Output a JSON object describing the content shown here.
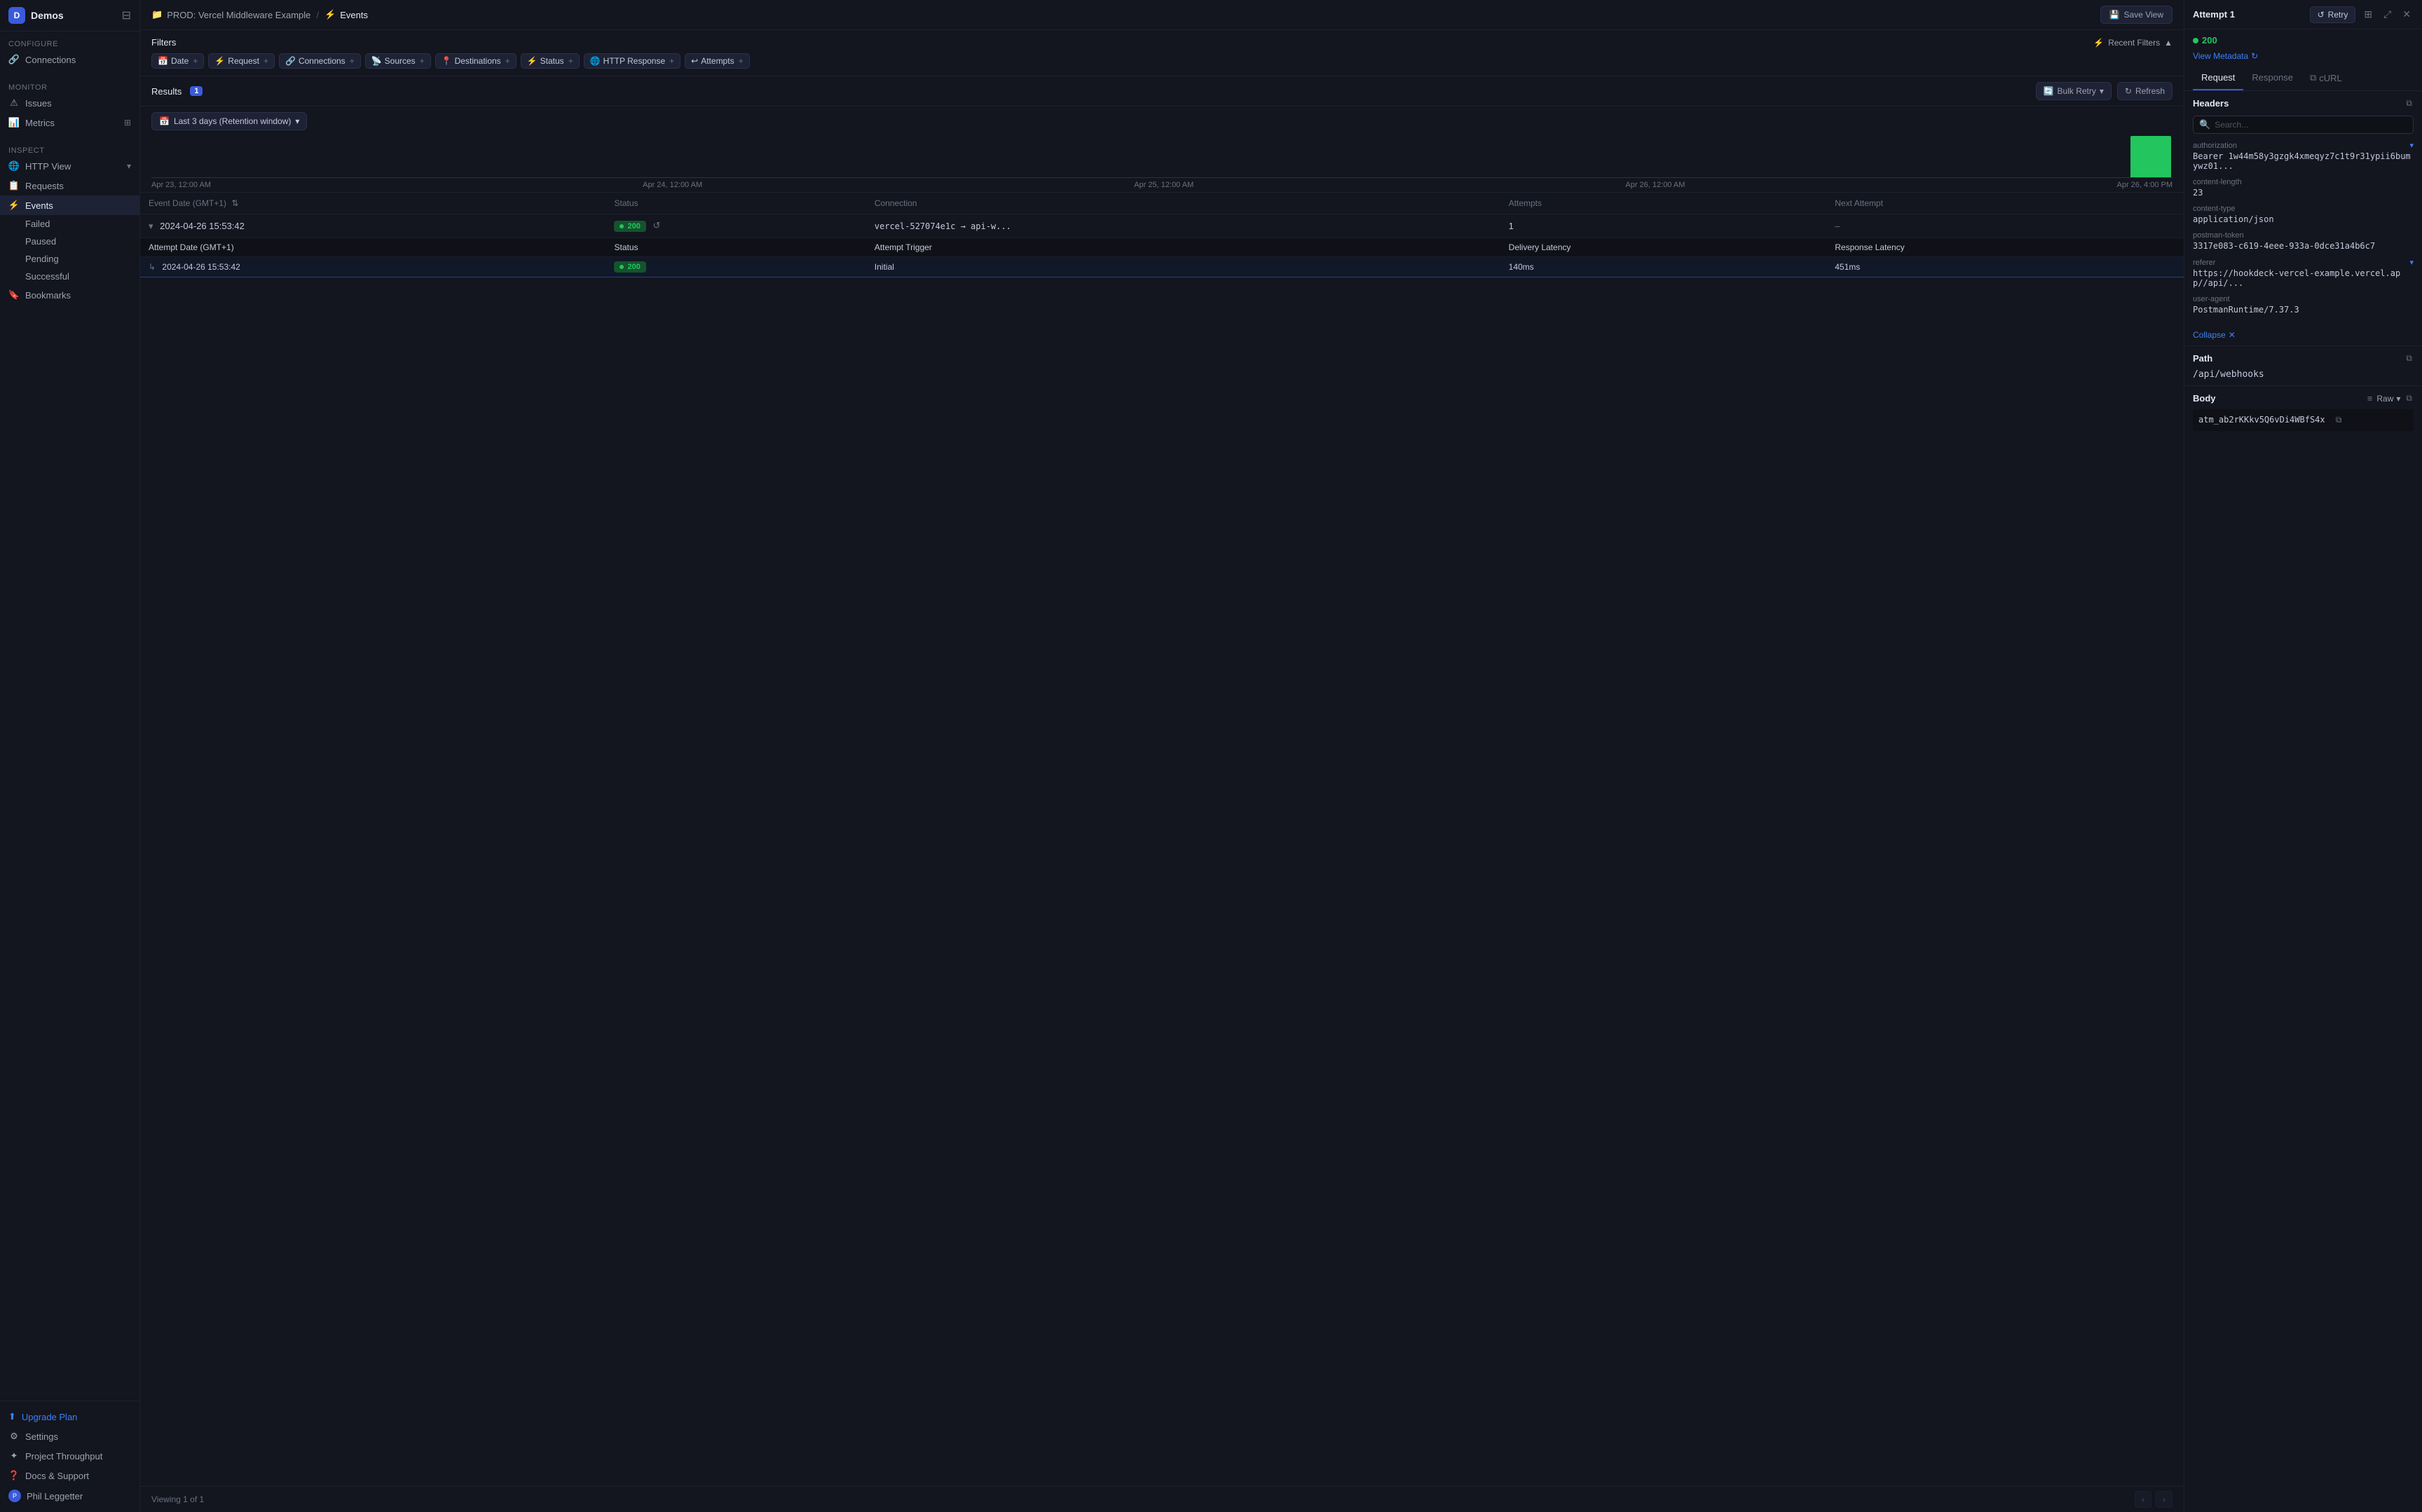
{
  "app": {
    "workspace": "Demos",
    "logo_letter": "D"
  },
  "sidebar": {
    "configure_label": "Configure",
    "connections_label": "Connections",
    "monitor_label": "Monitor",
    "issues_label": "Issues",
    "metrics_label": "Metrics",
    "inspect_label": "Inspect",
    "http_view_label": "HTTP View",
    "requests_label": "Requests",
    "events_label": "Events",
    "events_sub": [
      {
        "label": "Failed"
      },
      {
        "label": "Paused"
      },
      {
        "label": "Pending"
      },
      {
        "label": "Successful"
      }
    ],
    "bookmarks_label": "Bookmarks",
    "upgrade_label": "Upgrade Plan",
    "settings_label": "Settings",
    "project_throughput_label": "Project Throughput",
    "docs_support_label": "Docs & Support",
    "user_label": "Phil Leggetter"
  },
  "topbar": {
    "breadcrumb_icon": "📁",
    "breadcrumb_project": "PROD: Vercel Middleware Example",
    "breadcrumb_separator": "/",
    "breadcrumb_events": "Events",
    "save_view_label": "Save View"
  },
  "filters": {
    "title": "Filters",
    "recent_filters_label": "Recent Filters",
    "chips": [
      {
        "label": "Date",
        "icon": "📅"
      },
      {
        "label": "Request",
        "icon": "⚡"
      },
      {
        "label": "Connections",
        "icon": "🔗"
      },
      {
        "label": "Sources",
        "icon": "📡"
      },
      {
        "label": "Destinations",
        "icon": "📍"
      },
      {
        "label": "Status",
        "icon": "⚡"
      },
      {
        "label": "HTTP Response",
        "icon": "🌐"
      },
      {
        "label": "Attempts",
        "icon": "↩"
      }
    ]
  },
  "results": {
    "label": "Results",
    "count": "1",
    "bulk_retry_label": "Bulk Retry",
    "refresh_label": "Refresh",
    "date_range_label": "Last 3 days (Retention window)"
  },
  "chart": {
    "dates": [
      "Apr 23, 12:00 AM",
      "Apr 24, 12:00 AM",
      "Apr 25, 12:00 AM",
      "Apr 26, 12:00 AM",
      "Apr 26, 4:00 PM"
    ],
    "bars": [
      0,
      0,
      0,
      0,
      0,
      0,
      0,
      0,
      0,
      0,
      0,
      0,
      0,
      0,
      0,
      0,
      0,
      0,
      0,
      0,
      0,
      0,
      0,
      0,
      0,
      0,
      0,
      0,
      0,
      0,
      0,
      0,
      0,
      0,
      0,
      0,
      0,
      0,
      0,
      0,
      0,
      0,
      0,
      0,
      0,
      0,
      0,
      1
    ]
  },
  "table": {
    "columns": [
      "Event Date (GMT+1)",
      "Status",
      "Connection",
      "Attempts",
      "Next Attempt"
    ],
    "sub_columns": [
      "Attempt Date (GMT+1)",
      "Status",
      "Attempt Trigger",
      "Delivery Latency",
      "Response Latency"
    ],
    "rows": [
      {
        "date": "2024-04-26 15:53:42",
        "status": "200",
        "connection": "vercel-527074e1c → api-w...",
        "attempts": "1",
        "next_attempt": "–",
        "expanded": true,
        "sub_rows": [
          {
            "date": "2024-04-26 15:53:42",
            "status": "200",
            "trigger": "Initial",
            "delivery_latency": "140ms",
            "response_latency": "451ms"
          }
        ]
      }
    ]
  },
  "bottom": {
    "viewing_text": "Viewing 1 of 1"
  },
  "panel": {
    "title": "Attempt 1",
    "retry_label": "Retry",
    "status_code": "200",
    "view_metadata_label": "View Metadata",
    "tabs": [
      {
        "label": "Request",
        "active": true
      },
      {
        "label": "Response",
        "active": false
      },
      {
        "label": "cURL",
        "active": false
      }
    ],
    "headers_title": "Headers",
    "search_placeholder": "Search...",
    "headers": [
      {
        "key": "authorization",
        "value": "Bearer 1w44m58y3gzgk4xmeqyz7c1t9r31ypii6bumywz01...",
        "expandable": true
      },
      {
        "key": "content-length",
        "value": "23",
        "expandable": false
      },
      {
        "key": "content-type",
        "value": "application/json",
        "expandable": false
      },
      {
        "key": "postman-token",
        "value": "3317e083-c619-4eee-933a-0dce31a4b6c7",
        "expandable": false
      },
      {
        "key": "referer",
        "value": "https://hookdeck-vercel-example.vercel.app//api/...",
        "expandable": true
      },
      {
        "key": "user-agent",
        "value": "PostmanRuntime/7.37.3",
        "expandable": false
      }
    ],
    "collapse_label": "Collapse",
    "path_title": "Path",
    "path_value": "/api/webhooks",
    "body_title": "Body",
    "body_format": "Raw",
    "body_value": "atm_ab2rKKkv5Q6vDi4WBfS4x"
  }
}
